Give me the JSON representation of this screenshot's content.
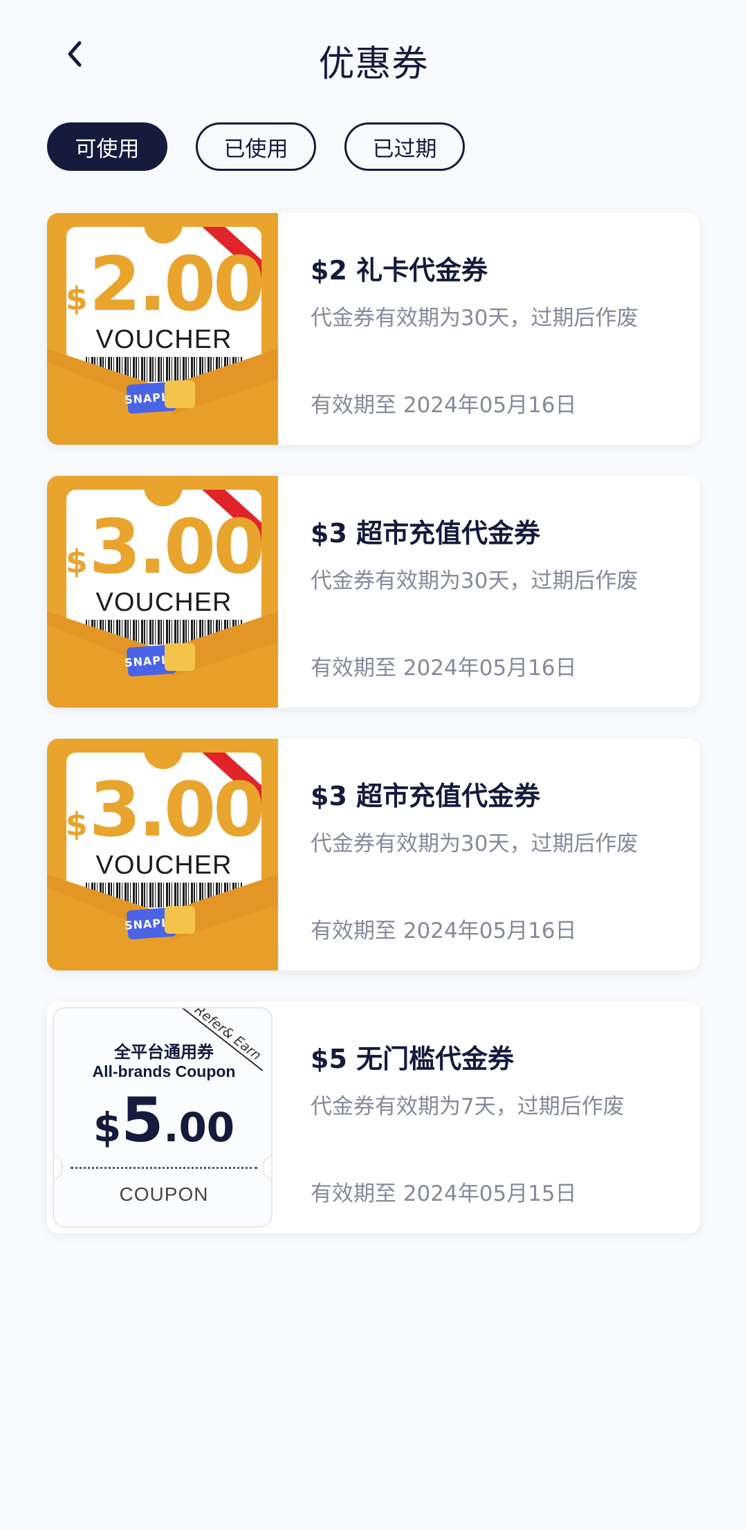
{
  "header": {
    "title": "优惠券"
  },
  "tabs": [
    {
      "label": "可使用",
      "active": true
    },
    {
      "label": "已使用",
      "active": false
    },
    {
      "label": "已过期",
      "active": false
    }
  ],
  "colors": {
    "navy": "#141b3c",
    "voucher_gold": "#e9a42e",
    "ribbon_red": "#e0242a",
    "snaplii_blue": "#4b63e6"
  },
  "coupons": [
    {
      "title": "$2 礼卡代金券",
      "desc": "代金券有效期为30天，过期后作废",
      "expiry": "有效期至 2024年05月16日",
      "image": {
        "dollar": "$",
        "amount": "2.00",
        "label": "VOUCHER",
        "logo": "SNAPLII"
      }
    },
    {
      "title": "$3 超市充值代金券",
      "desc": "代金券有效期为30天，过期后作废",
      "expiry": "有效期至 2024年05月16日",
      "image": {
        "dollar": "$",
        "amount": "3.00",
        "label": "VOUCHER",
        "logo": "SNAPLII"
      }
    },
    {
      "title": "$3 超市充值代金券",
      "desc": "代金券有效期为30天，过期后作废",
      "expiry": "有效期至 2024年05月16日",
      "image": {
        "dollar": "$",
        "amount": "3.00",
        "label": "VOUCHER",
        "logo": "SNAPLII"
      }
    },
    {
      "title": "$5 无门槛代金券",
      "desc": "代金券有效期为7天，过期后作废",
      "expiry": "有效期至 2024年05月15日",
      "image": {
        "tag": "Refer& Earn",
        "cn": "全平台通用券",
        "en": "All-brands Coupon",
        "dollar": "$",
        "num": "5",
        "dec": ".00",
        "word": "COUPON"
      }
    }
  ]
}
